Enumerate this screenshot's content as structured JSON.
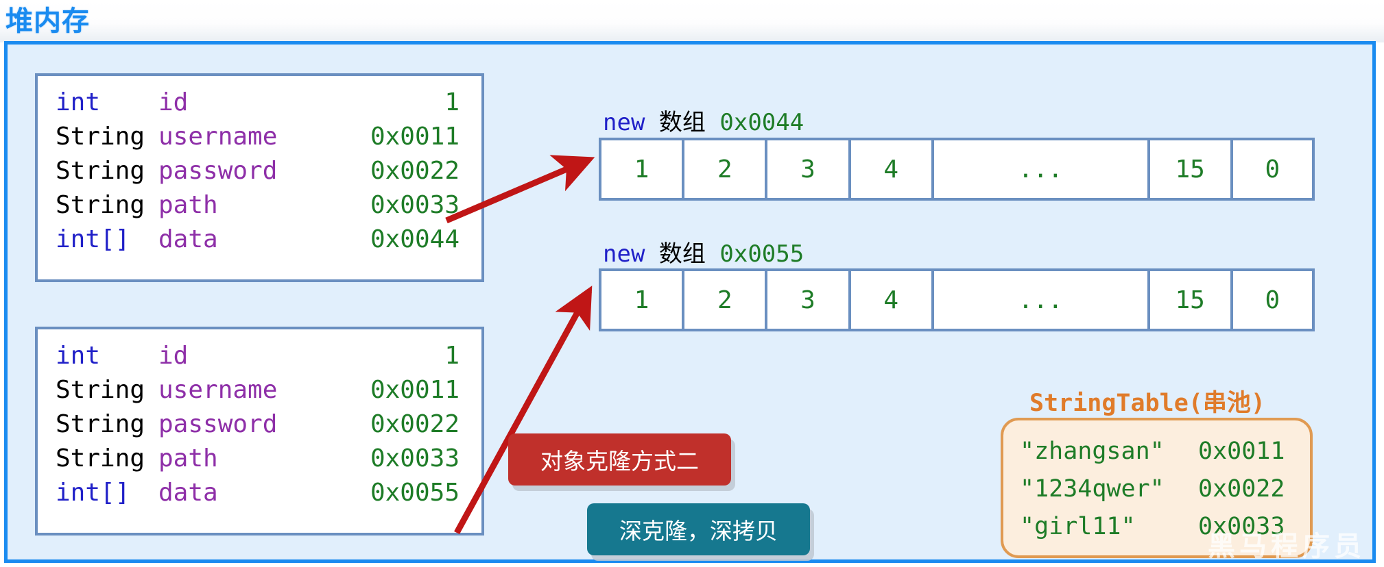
{
  "page": {
    "title": "堆内存",
    "watermark": "黑马程序员"
  },
  "colors": {
    "title_blue": "#1a8bf0",
    "panel_bg": "#e1effc",
    "panel_border": "#1a8bf0",
    "box_border": "#6a8fc0",
    "keyword_blue": "#2020c8",
    "field_purple": "#8e2fa8",
    "value_green": "#1e7c27",
    "arrow_red": "#c01616",
    "callout_red": "#c0302b",
    "callout_teal": "#16788f",
    "stringtable_orange": "#e07b2a",
    "stringtable_bg": "#fceede"
  },
  "objects": [
    {
      "name": "object-1",
      "fields": [
        {
          "type": "int",
          "type_kind": "kw",
          "field": "id",
          "value": "1"
        },
        {
          "type": "String",
          "type_kind": "cls",
          "field": "username",
          "value": "0x0011"
        },
        {
          "type": "String",
          "type_kind": "cls",
          "field": "password",
          "value": "0x0022"
        },
        {
          "type": "String",
          "type_kind": "cls",
          "field": "path",
          "value": "0x0033"
        },
        {
          "type": "int[]",
          "type_kind": "kw",
          "field": "data",
          "value": "0x0044"
        }
      ]
    },
    {
      "name": "object-2",
      "fields": [
        {
          "type": "int",
          "type_kind": "kw",
          "field": "id",
          "value": "1"
        },
        {
          "type": "String",
          "type_kind": "cls",
          "field": "username",
          "value": "0x0011"
        },
        {
          "type": "String",
          "type_kind": "cls",
          "field": "password",
          "value": "0x0022"
        },
        {
          "type": "String",
          "type_kind": "cls",
          "field": "path",
          "value": "0x0033"
        },
        {
          "type": "int[]",
          "type_kind": "kw",
          "field": "data",
          "value": "0x0055"
        }
      ]
    }
  ],
  "arrays": [
    {
      "name": "array-1",
      "caption_new": "new",
      "caption_cn": "数组",
      "caption_addr": "0x0044",
      "cells": [
        "1",
        "2",
        "3",
        "4",
        "...",
        "15",
        "0"
      ]
    },
    {
      "name": "array-2",
      "caption_new": "new",
      "caption_cn": "数组",
      "caption_addr": "0x0055",
      "cells": [
        "1",
        "2",
        "3",
        "4",
        "...",
        "15",
        "0"
      ]
    }
  ],
  "callouts": {
    "clone_mode": "对象克隆方式二",
    "deep_clone": "深克隆，深拷贝"
  },
  "string_table": {
    "title": "StringTable(串池)",
    "entries": [
      {
        "literal": "\"zhangsan\"",
        "address": "0x0011"
      },
      {
        "literal": "\"1234qwer\"",
        "address": "0x0022"
      },
      {
        "literal": "\"girl11\"",
        "address": "0x0033"
      }
    ]
  },
  "arrows": [
    {
      "name": "arrow-object1-to-array1",
      "from": "object-1.data (0x0044)",
      "to": "array-1 left edge"
    },
    {
      "name": "arrow-object2-to-array2",
      "from": "object-2.data (0x0055)",
      "to": "array-2 left edge"
    }
  ]
}
